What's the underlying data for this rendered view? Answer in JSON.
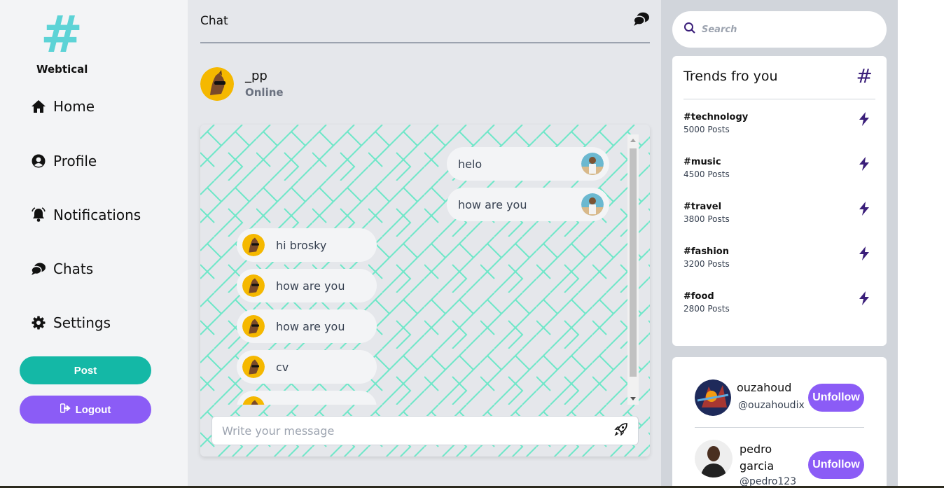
{
  "sidebar": {
    "logo_text": "Webtical",
    "items": [
      {
        "label": "Home",
        "icon": "home-icon"
      },
      {
        "label": "Profile",
        "icon": "user-circle-icon"
      },
      {
        "label": "Notifications",
        "icon": "bell-icon"
      },
      {
        "label": "Chats",
        "icon": "chat-bubbles-icon"
      },
      {
        "label": "Settings",
        "icon": "gear-icon"
      }
    ],
    "post_label": "Post",
    "logout_label": "Logout"
  },
  "chat": {
    "title": "Chat",
    "user": {
      "name": "_pp",
      "status": "Online"
    },
    "messages": [
      {
        "text": "helo",
        "direction": "out"
      },
      {
        "text": "how are you",
        "direction": "out"
      },
      {
        "text": "hi brosky",
        "direction": "in"
      },
      {
        "text": "how are you",
        "direction": "in"
      },
      {
        "text": "how are you",
        "direction": "in"
      },
      {
        "text": "cv",
        "direction": "in"
      },
      {
        "text": "",
        "direction": "in"
      }
    ],
    "input_placeholder": "Write your message"
  },
  "search": {
    "placeholder": "Search"
  },
  "trends": {
    "title": "Trends fro you",
    "items": [
      {
        "tag": "#technology",
        "count": "5000 Posts"
      },
      {
        "tag": "#music",
        "count": "4500 Posts"
      },
      {
        "tag": "#travel",
        "count": "3800 Posts"
      },
      {
        "tag": "#fashion",
        "count": "3200 Posts"
      },
      {
        "tag": "#food",
        "count": "2800 Posts"
      }
    ]
  },
  "follows": [
    {
      "name": "ouzahoud",
      "handle": "@ouzahoudix",
      "button": "Unfollow"
    },
    {
      "name": "pedro garcia",
      "handle": "@pedro123",
      "button": "Unfollow"
    }
  ],
  "colors": {
    "teal": "#14b8a6",
    "purple": "#8b5cf6",
    "logo": "#5dd3d6",
    "pattern": "#5eead4"
  }
}
